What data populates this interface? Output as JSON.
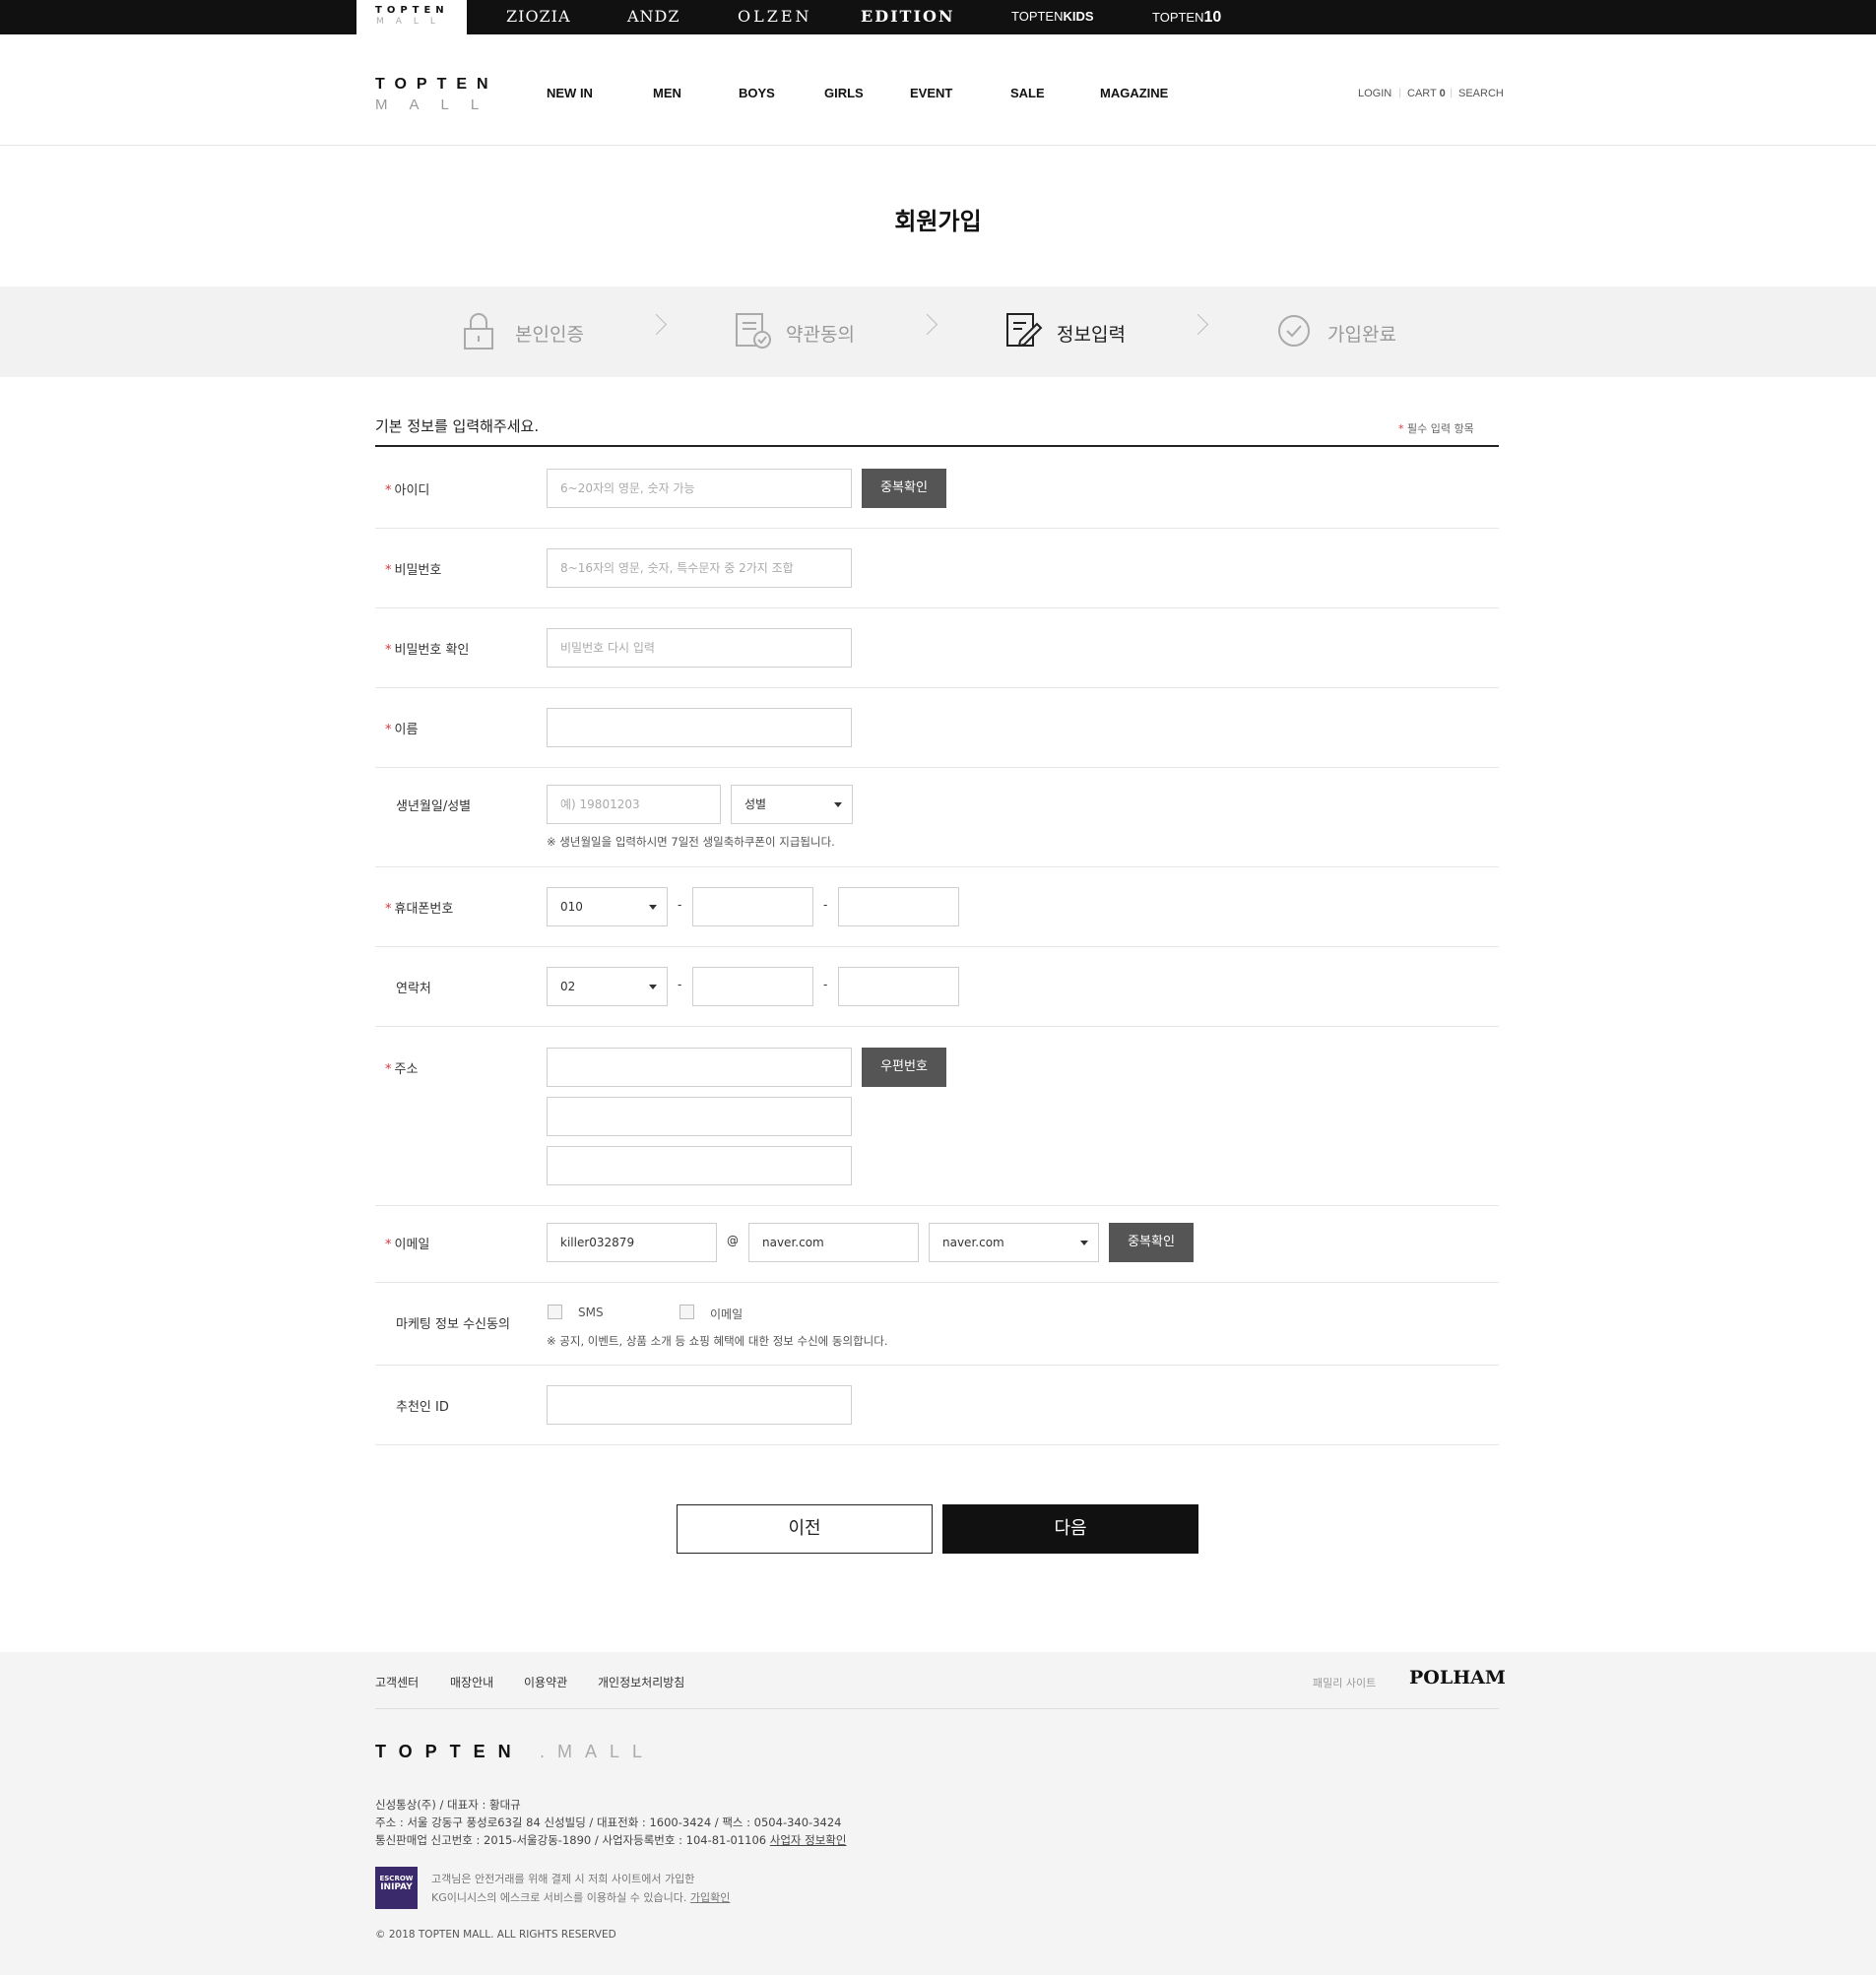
{
  "brand_bar": {
    "active": {
      "line1": "TOPTEN",
      "line2": "MALL"
    },
    "brands": [
      "ZIOZIA",
      "ANDZ",
      "OLZEN",
      "EDITION",
      "TOPTEN",
      "KIDS",
      "TOPTEN",
      "10"
    ]
  },
  "header": {
    "logo_line1": "TOPTEN",
    "logo_line2": "MALL",
    "nav": [
      "NEW IN",
      "MEN",
      "BOYS",
      "GIRLS",
      "EVENT",
      "SALE",
      "MAGAZINE"
    ],
    "util": {
      "login": "LOGIN",
      "cart": "CART",
      "cart_count": "0",
      "search": "SEARCH"
    }
  },
  "page_title": "회원가입",
  "steps": [
    {
      "label": "본인인증",
      "icon": "lock-icon"
    },
    {
      "label": "약관동의",
      "icon": "document-check-icon"
    },
    {
      "label": "정보입력",
      "icon": "edit-icon",
      "active": true
    },
    {
      "label": "가입완료",
      "icon": "check-circle-icon"
    }
  ],
  "form": {
    "title": "기본 정보를 입력해주세요.",
    "required_note": "필수 입력 항목",
    "required_mark": "*",
    "id": {
      "label": "아이디",
      "placeholder": "6~20자의 영문, 숫자 가능",
      "button": "중복확인"
    },
    "password": {
      "label": "비밀번호",
      "placeholder": "8~16자의 영문, 숫자, 특수문자 중 2가지 조합"
    },
    "password_confirm": {
      "label": "비밀번호 확인",
      "placeholder": "비밀번호 다시 입력"
    },
    "name": {
      "label": "이름"
    },
    "birth": {
      "label": "생년월일/성별",
      "placeholder": "예) 19801203",
      "gender_select": "성별",
      "note": "※ 생년월일을 입력하시면 7일전 생일축하쿠폰이 지급됩니다."
    },
    "mobile": {
      "label": "휴대폰번호",
      "prefix": "010",
      "dash": "-"
    },
    "phone": {
      "label": "연락처",
      "prefix": "02",
      "dash": "-"
    },
    "address": {
      "label": "주소",
      "button": "우편번호"
    },
    "email": {
      "label": "이메일",
      "local": "killer032879",
      "at": "@",
      "domain": "naver.com",
      "domain_select": "naver.com",
      "button": "중복확인"
    },
    "marketing": {
      "label": "마케팅 정보 수신동의",
      "sms": "SMS",
      "email": "이메일",
      "note": "※ 공지, 이벤트, 상품 소개 등 쇼핑 혜택에 대한 정보 수신에 동의합니다."
    },
    "recommender": {
      "label": "추천인 ID"
    }
  },
  "buttons": {
    "prev": "이전",
    "next": "다음"
  },
  "footer": {
    "links": [
      "고객센터",
      "매장안내",
      "이용약관",
      "개인정보처리방침"
    ],
    "family_site": "패밀리 사이트",
    "family_brand": "POLHAM",
    "logo_main": "TOPTEN",
    "logo_sub": ".MALL",
    "info1": "신성통상(주) / 대표자 : 황대규",
    "info2": "주소 : 서울 강동구 풍성로63길 84 신성빌딩 / 대표전화 : 1600-3424 / 팩스 : 0504-340-3424",
    "info3": "통신판매업 신고번호 : 2015-서울강동-1890 / 사업자등록번호 : 104-81-01106",
    "biz_info_link": "사업자 정보확인",
    "escrow_badge": [
      "ESCROW",
      "INIPAY"
    ],
    "escrow1": "고객님은 안전거래를 위해 결제 시 저희 사이트에서 가입한",
    "escrow2": "KG이니시스의 에스크로 서비스를 이용하실 수 있습니다.",
    "escrow_link": "가입확인",
    "copyright": "© 2018 TOPTEN MALL. ALL RIGHTS RESERVED"
  }
}
